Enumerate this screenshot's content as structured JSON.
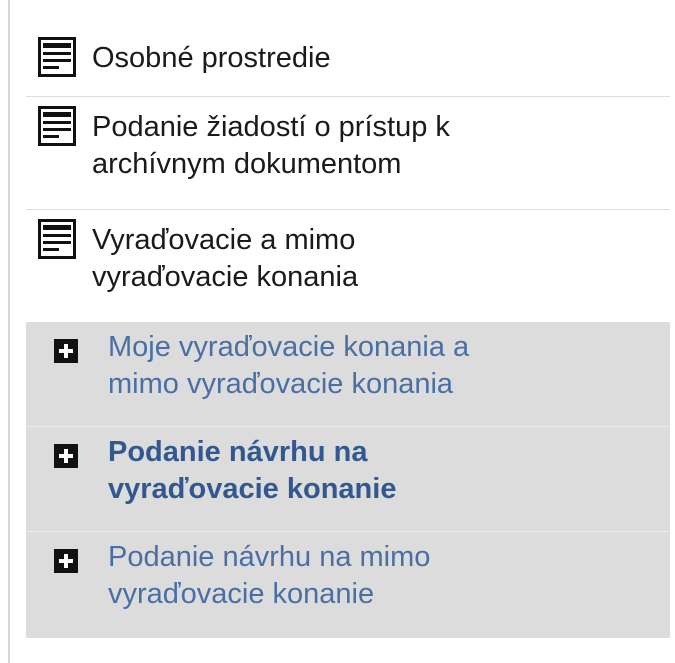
{
  "menu": {
    "items": [
      {
        "label": "Osobné prostredie",
        "icon": "document-icon"
      },
      {
        "label": "Podanie žiadostí o prístup k\narchívnym dokumentom",
        "icon": "document-icon"
      },
      {
        "label": "Vyraďovacie a mimo\nvyraďovacie konania",
        "icon": "document-icon"
      }
    ],
    "subitems": [
      {
        "label": "Moje vyraďovacie konania a\nmimo vyraďovacie konania",
        "icon": "plus-icon"
      },
      {
        "label": "Podanie návrhu na\nvyraďovacie konanie",
        "icon": "plus-icon",
        "active": true
      },
      {
        "label": "Podanie návrhu na mimo\nvyraďovacie konanie",
        "icon": "plus-icon"
      }
    ]
  },
  "colors": {
    "text": "#1a1a1a",
    "link": "#4a6fa5",
    "active_link": "#31588f",
    "submenu_bg": "#dcdcdc",
    "divider": "#dedede"
  }
}
